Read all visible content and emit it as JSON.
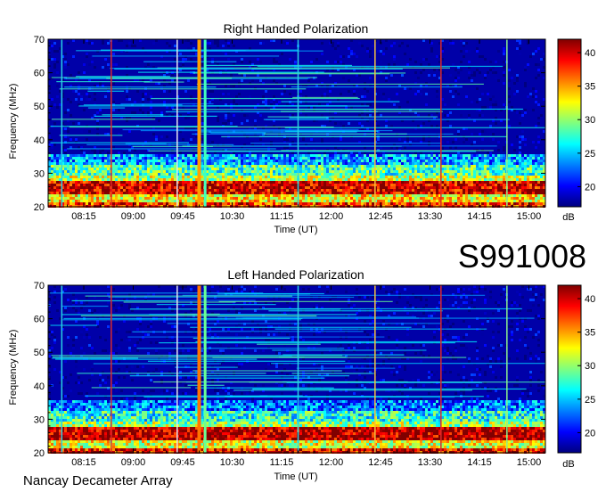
{
  "panel_top": {
    "title": "Right Handed Polarization"
  },
  "panel_bottom": {
    "title": "Left Handed Polarization"
  },
  "observation_id": "S991008",
  "footer_label": "Nancay Decameter Array",
  "chart_data": [
    {
      "type": "heatmap",
      "title": "Right Handed Polarization",
      "xlabel": "Time (UT)",
      "ylabel": "Frequency (MHz)",
      "x_ticks": [
        "08:15",
        "09:00",
        "09:45",
        "10:30",
        "11:15",
        "12:00",
        "12:45",
        "13:30",
        "14:15",
        "15:00"
      ],
      "y_ticks": [
        20,
        30,
        40,
        50,
        60,
        70
      ],
      "ylim": [
        20,
        70
      ],
      "colorbar": {
        "label": "dB",
        "ticks": [
          20,
          25,
          30,
          35,
          40
        ],
        "range": [
          17,
          42
        ],
        "colormap": "jet"
      },
      "background_db": 18,
      "bands_mhz": [
        {
          "from": 20,
          "to": 22,
          "db": 38
        },
        {
          "from": 22,
          "to": 24,
          "db": 33
        },
        {
          "from": 24,
          "to": 28,
          "db": 40
        },
        {
          "from": 28,
          "to": 30,
          "db": 31
        },
        {
          "from": 30,
          "to": 33,
          "db": 28
        },
        {
          "from": 33,
          "to": 36,
          "db": 24
        }
      ],
      "bursts": [
        {
          "time": "10:00",
          "db": 35,
          "from_mhz": 20,
          "to_mhz": 70
        },
        {
          "time": "10:05",
          "db": 28,
          "from_mhz": 20,
          "to_mhz": 70
        }
      ],
      "vertical_markers": [
        {
          "time": "07:55",
          "color": "#28d2e6"
        },
        {
          "time": "08:40",
          "color": "#dc2a2a"
        },
        {
          "time": "09:40",
          "color": "#e6e6f0"
        },
        {
          "time": "11:30",
          "color": "#28d2e6"
        },
        {
          "time": "12:40",
          "color": "#f4c040"
        },
        {
          "time": "13:40",
          "color": "#dc2a2a"
        },
        {
          "time": "14:40",
          "color": "#8cf08c"
        }
      ]
    },
    {
      "type": "heatmap",
      "title": "Left Handed Polarization",
      "xlabel": "Time (UT)",
      "ylabel": "Frequency (MHz)",
      "x_ticks": [
        "08:15",
        "09:00",
        "09:45",
        "10:30",
        "11:15",
        "12:00",
        "12:45",
        "13:30",
        "14:15",
        "15:00"
      ],
      "y_ticks": [
        20,
        30,
        40,
        50,
        60,
        70
      ],
      "ylim": [
        20,
        70
      ],
      "colorbar": {
        "label": "dB",
        "ticks": [
          20,
          25,
          30,
          35,
          40
        ],
        "range": [
          17,
          42
        ],
        "colormap": "jet"
      },
      "background_db": 18,
      "bands_mhz": [
        {
          "from": 20,
          "to": 22,
          "db": 39
        },
        {
          "from": 22,
          "to": 24,
          "db": 32
        },
        {
          "from": 24,
          "to": 28,
          "db": 41
        },
        {
          "from": 28,
          "to": 30,
          "db": 30
        },
        {
          "from": 30,
          "to": 33,
          "db": 27
        },
        {
          "from": 33,
          "to": 36,
          "db": 23
        }
      ],
      "bursts": [
        {
          "time": "10:00",
          "db": 36,
          "from_mhz": 20,
          "to_mhz": 70
        },
        {
          "time": "10:05",
          "db": 29,
          "from_mhz": 20,
          "to_mhz": 70
        }
      ],
      "vertical_markers": [
        {
          "time": "07:55",
          "color": "#28d2e6"
        },
        {
          "time": "08:40",
          "color": "#dc2a2a"
        },
        {
          "time": "09:40",
          "color": "#e6e6f0"
        },
        {
          "time": "11:30",
          "color": "#28d2e6"
        },
        {
          "time": "12:40",
          "color": "#f4c040"
        },
        {
          "time": "13:40",
          "color": "#dc2a2a"
        },
        {
          "time": "14:40",
          "color": "#8cf08c"
        }
      ]
    }
  ]
}
